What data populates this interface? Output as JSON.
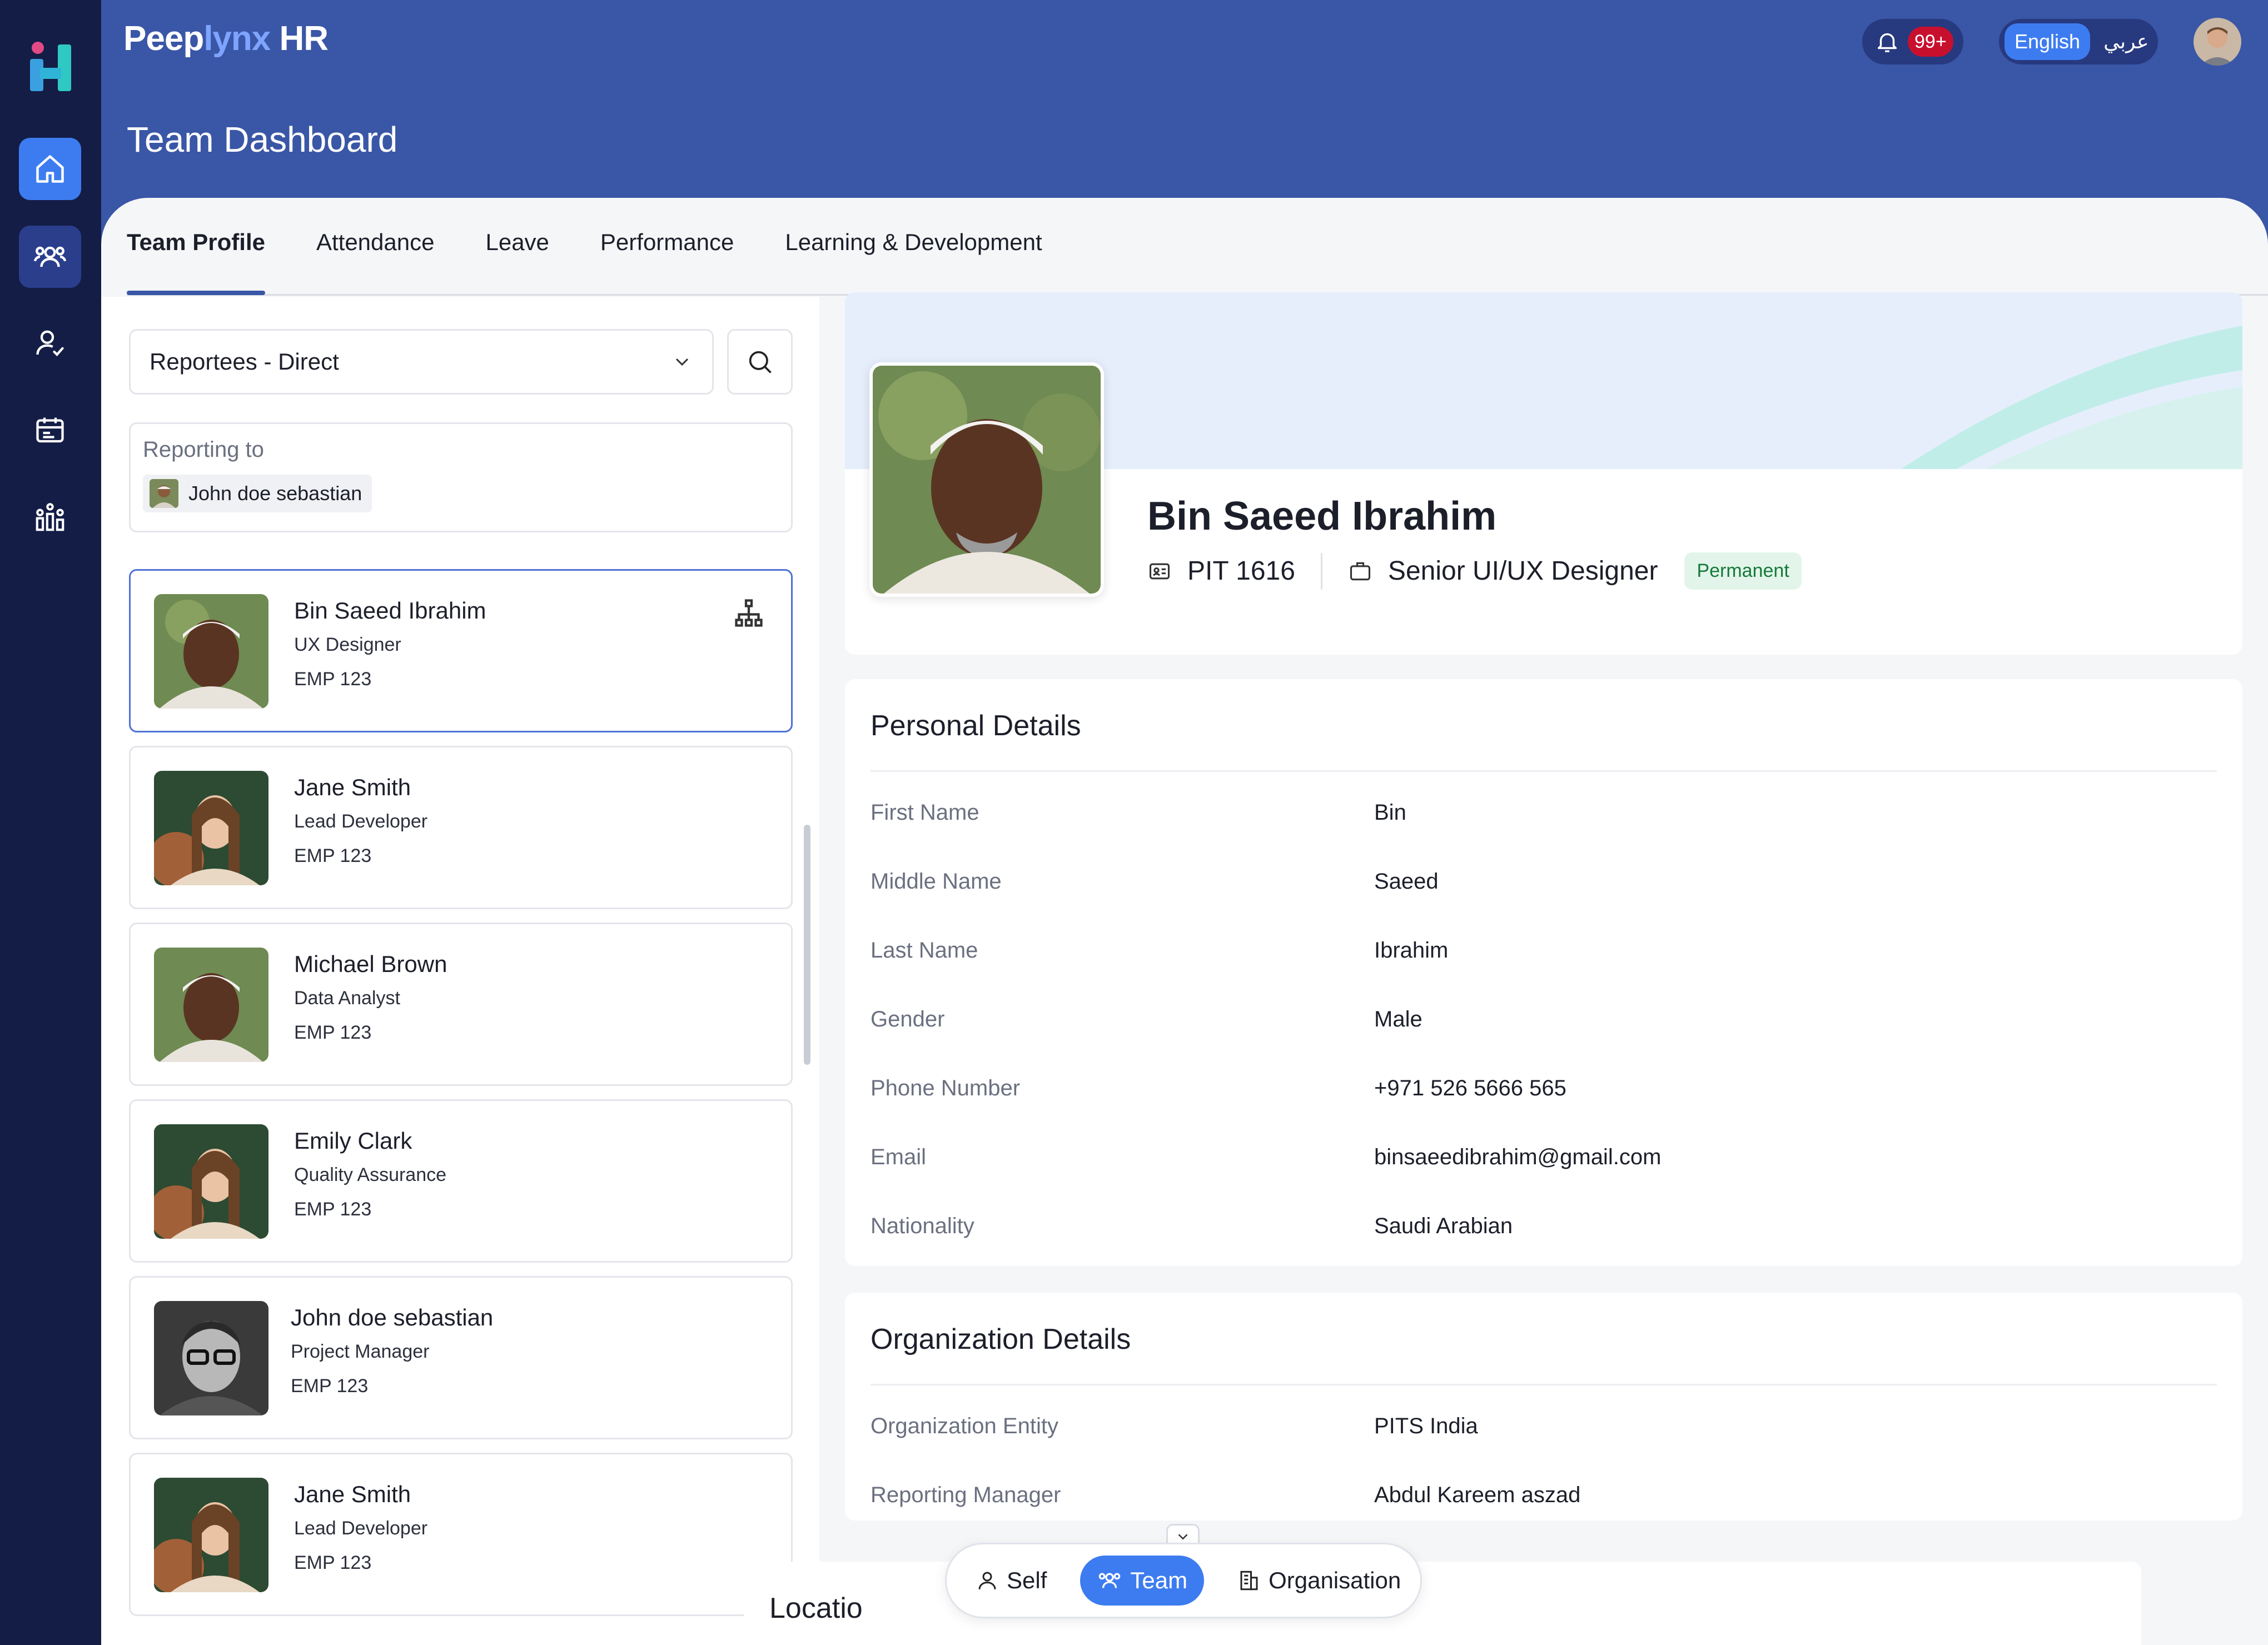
{
  "app": {
    "brand_prefix": "Peep",
    "brand_accent": "lynx",
    "brand_suffix": " HR",
    "page_title": "Team Dashboard",
    "notification_count": "99+",
    "lang_active": "English",
    "lang_other": "عربي",
    "colors": {
      "header": "#3a56a6",
      "sidebar": "#141d46",
      "accent": "#3d7cf0",
      "permanent_badge": "#e3f5ea"
    }
  },
  "sidebar": {
    "items": [
      {
        "icon": "home-icon"
      },
      {
        "icon": "team-icon"
      },
      {
        "icon": "user-check-icon"
      },
      {
        "icon": "calendar-icon"
      },
      {
        "icon": "org-chart-icon"
      }
    ]
  },
  "tabs": [
    "Team Profile",
    "Attendance",
    "Leave",
    "Performance",
    "Learning & Development"
  ],
  "filter": {
    "selected": "Reportees - Direct"
  },
  "reporting": {
    "label": "Reporting to",
    "manager": "John doe sebastian"
  },
  "employees": [
    {
      "name": "Bin Saeed Ibrahim",
      "role": "UX Designer",
      "id": "EMP 123"
    },
    {
      "name": "Jane Smith",
      "role": "Lead Developer",
      "id": "EMP 123"
    },
    {
      "name": "Michael Brown",
      "role": "Data Analyst",
      "id": "EMP 123"
    },
    {
      "name": "Emily Clark",
      "role": "Quality Assurance",
      "id": "EMP 123"
    },
    {
      "name": "John doe sebastian",
      "role": "Project Manager",
      "id": "EMP 123"
    },
    {
      "name": "Jane Smith",
      "role": "Lead Developer",
      "id": "EMP 123"
    }
  ],
  "profile": {
    "name": "Bin Saeed Ibrahim",
    "pit": "PIT 1616",
    "designation": "Senior UI/UX Designer",
    "status": "Permanent"
  },
  "personal": {
    "title": "Personal Details",
    "rows": [
      {
        "label": "First Name",
        "value": "Bin"
      },
      {
        "label": "Middle Name",
        "value": "Saeed"
      },
      {
        "label": "Last Name",
        "value": "Ibrahim"
      },
      {
        "label": "Gender",
        "value": "Male"
      },
      {
        "label": "Phone Number",
        "value": "+971 526 5666 565"
      },
      {
        "label": "Email",
        "value": "binsaeedibrahim@gmail.com"
      },
      {
        "label": "Nationality",
        "value": "Saudi Arabian"
      }
    ]
  },
  "organization": {
    "title": "Organization Details",
    "rows": [
      {
        "label": "Organization Entity",
        "value": "PITS India"
      },
      {
        "label": "Reporting Manager",
        "value": "Abdul Kareem aszad"
      }
    ]
  },
  "location": {
    "title": "Locatio"
  },
  "switcher": {
    "self": "Self",
    "team": "Team",
    "organisation": "Organisation"
  }
}
